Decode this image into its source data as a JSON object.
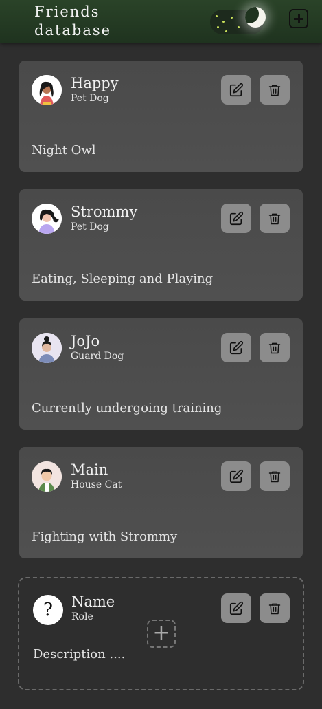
{
  "header": {
    "title": "Friends database",
    "theme_toggle_icon": "moon-icon",
    "add_icon": "plus-square-icon",
    "bg_color": "#244024"
  },
  "friends": [
    {
      "name": "Happy",
      "role": "Pet Dog",
      "description": "Night Owl",
      "avatar": "woman-avatar"
    },
    {
      "name": "Strommy",
      "role": "Pet Dog",
      "description": "Eating, Sleeping and Playing",
      "avatar": "woman-avatar"
    },
    {
      "name": "JoJo",
      "role": "Guard Dog",
      "description": "Currently undergoing training",
      "avatar": "woman-avatar"
    },
    {
      "name": "Main",
      "role": "House Cat",
      "description": "Fighting with Strommy",
      "avatar": "man-avatar"
    }
  ],
  "new_friend": {
    "avatar_glyph": "?",
    "name": "Name",
    "role": "Role",
    "description": "Description ....",
    "add_glyph": "+"
  },
  "icons": {
    "edit": "edit-icon",
    "delete": "trash-icon"
  }
}
